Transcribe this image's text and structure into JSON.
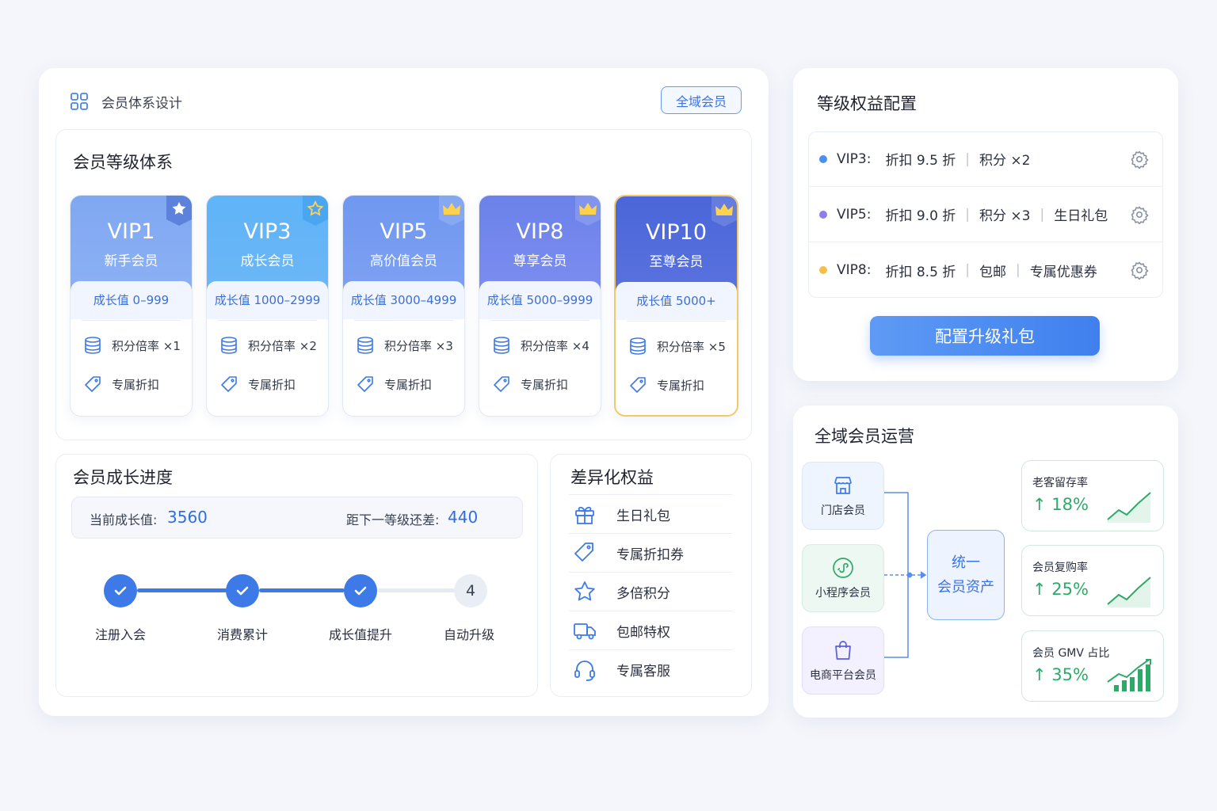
{
  "header": {
    "title": "会员体系设计",
    "pill": "全域会员"
  },
  "tiers": {
    "title": "会员等级体系",
    "items": [
      {
        "name": "VIP1",
        "sub": "新手会员",
        "range": "成长值   0–999",
        "rate": "积分倍率  ×1",
        "discount": "专属折扣"
      },
      {
        "name": "VIP3",
        "sub": "成长会员",
        "range": "成长值 1000–2999",
        "rate": "积分倍率  ×2",
        "discount": "专属折扣"
      },
      {
        "name": "VIP5",
        "sub": "高价值会员",
        "range": "成长值 3000–4999",
        "rate": "积分倍率  ×3",
        "discount": "专属折扣"
      },
      {
        "name": "VIP8",
        "sub": "尊享会员",
        "range": "成长值 5000–9999",
        "rate": "积分倍率  ×4",
        "discount": "专属折扣"
      },
      {
        "name": "VIP10",
        "sub": "至尊会员",
        "range": "成长值  5000+",
        "rate": "积分倍率  ×5",
        "discount": "专属折扣"
      }
    ]
  },
  "progress": {
    "title": "会员成长进度",
    "current_label": "当前成长值:",
    "current_value": "3560",
    "next_label": "距下一等级还差:",
    "next_value": "440",
    "steps": [
      "注册入会",
      "消费累计",
      "成长值提升",
      "自动升级"
    ],
    "pending_step_number": "4"
  },
  "benefits": {
    "title": "差异化权益",
    "items": [
      "生日礼包",
      "专属折扣券",
      "多倍积分",
      "包邮特权",
      "专属客服"
    ]
  },
  "config": {
    "title": "等级权益配置",
    "rows": [
      {
        "level": "VIP3:",
        "parts": [
          "折扣 9.5 折",
          "积分  ×2"
        ],
        "color": "#4a90f0"
      },
      {
        "level": "VIP5:",
        "parts": [
          "折扣 9.0 折",
          "积分  ×3",
          "生日礼包"
        ],
        "color": "#8b7ef0"
      },
      {
        "level": "VIP8:",
        "parts": [
          "折扣 8.5 折",
          "包邮",
          "专属优惠券"
        ],
        "color": "#f5c04a"
      }
    ],
    "button": "配置升级礼包"
  },
  "ops": {
    "title": "全域会员运营",
    "sources": [
      "门店会员",
      "小程序会员",
      "电商平台会员"
    ],
    "hub": [
      "统一",
      "会员资产"
    ],
    "kpis": [
      {
        "label": "老客留存率",
        "value": "↑ 18%"
      },
      {
        "label": "会员复购率",
        "value": "↑ 25%"
      },
      {
        "label": "会员 GMV 占比",
        "value": "↑ 35%"
      }
    ]
  },
  "colors": {
    "accent": "#3d7ae8",
    "success": "#2daa6a",
    "gold": "#f1c96a"
  }
}
